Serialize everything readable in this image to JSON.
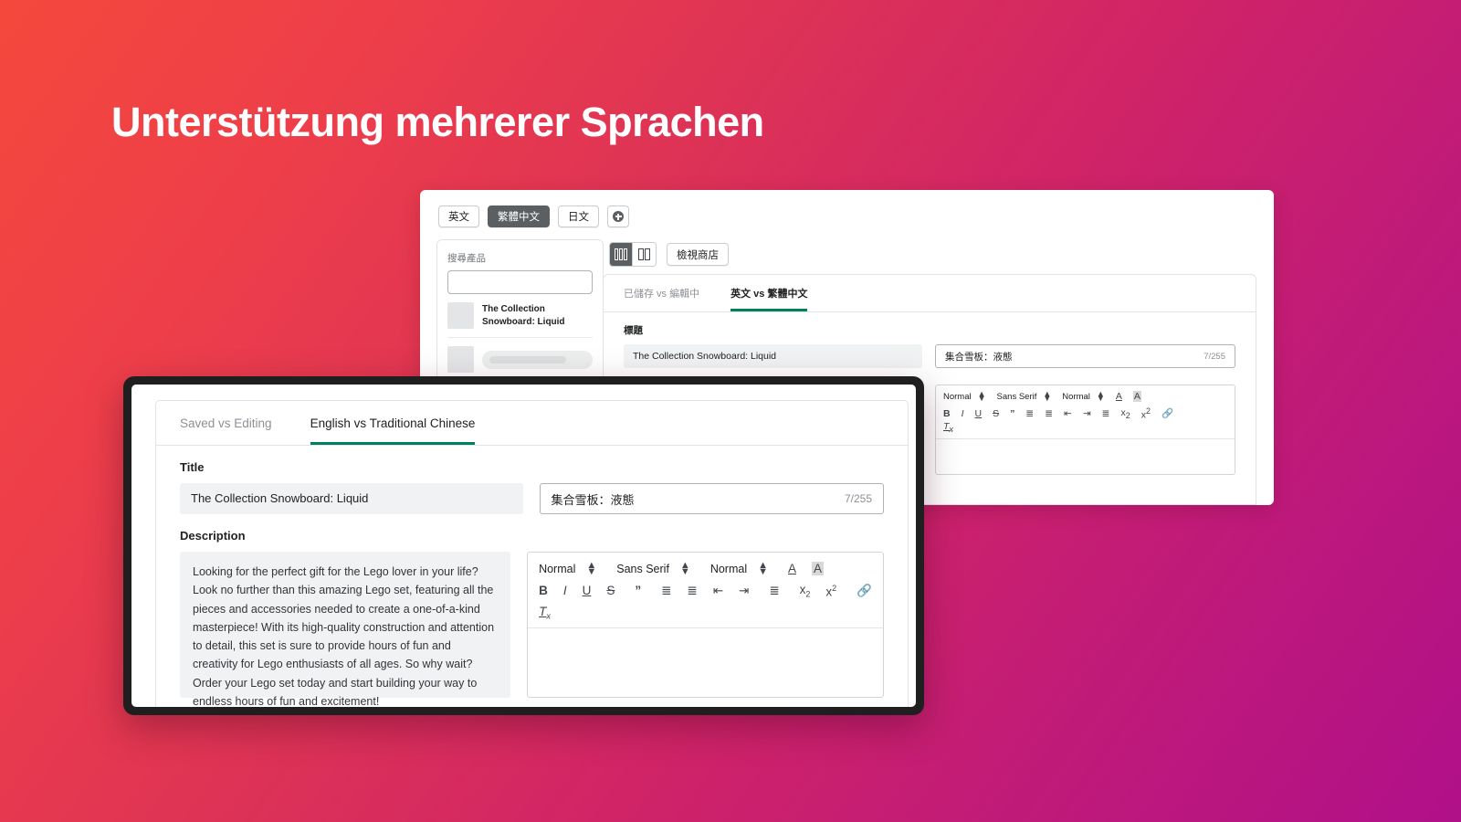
{
  "headline": "Unterstützung mehrerer Sprachen",
  "colors": {
    "gradient_start": "#f4483c",
    "gradient_mid": "#de3355",
    "gradient_end": "#b01089",
    "accent_green": "#008060",
    "chip_active_bg": "#5c5f62"
  },
  "back_panel": {
    "language_tabs": [
      {
        "label": "英文",
        "active": false
      },
      {
        "label": "繁體中文",
        "active": true
      },
      {
        "label": "日文",
        "active": false
      }
    ],
    "add_language_icon": "plus-circle-icon",
    "sidebar": {
      "search_label": "搜尋產品",
      "search_value": "",
      "items": [
        {
          "title": "The Collection Snowboard: Liquid",
          "placeholder": false
        },
        {
          "title": "",
          "placeholder": true
        },
        {
          "title": "",
          "placeholder": true
        }
      ]
    },
    "view_toggle": [
      {
        "icon": "three-column-icon",
        "active": true
      },
      {
        "icon": "two-column-icon",
        "active": false
      }
    ],
    "view_store_button": "檢視商店",
    "tabs": [
      {
        "label": "已儲存 vs 編輯中",
        "active": false
      },
      {
        "label": "英文 vs 繁體中文",
        "active": true
      }
    ],
    "title_label": "標題",
    "title_source": "The Collection Snowboard: Liquid",
    "title_translation": "集合雪板：液態",
    "title_counter": "7/255",
    "editor_toolbar": {
      "heading_select": "Normal",
      "font_select": "Sans Serif",
      "size_select": "Normal",
      "text_color_icon": "A",
      "bg_color_icon": "A",
      "bold": "B",
      "italic": "I",
      "underline": "U",
      "strike": "S",
      "blockquote": "”",
      "ordered_list": "ordered-list-icon",
      "bullet_list": "bullet-list-icon",
      "outdent": "outdent-icon",
      "indent": "indent-icon",
      "align": "align-icon",
      "subscript": "x",
      "subscript_mark": "2",
      "superscript": "x",
      "superscript_mark": "2",
      "link": "link-icon",
      "clear_format": "T",
      "clear_format_mark": "x"
    }
  },
  "front_panel": {
    "tabs": [
      {
        "label": "Saved vs Editing",
        "active": false
      },
      {
        "label": "English vs Traditional Chinese",
        "active": true
      }
    ],
    "title_label": "Title",
    "title_source": "The Collection Snowboard: Liquid",
    "title_translation": "集合雪板：液態",
    "title_counter": "7/255",
    "description_label": "Description",
    "description_source": "Looking for the perfect gift for the Lego lover in your life? Look no further than this amazing Lego set, featuring all the pieces and accessories needed to create a one-of-a-kind masterpiece! With its high-quality construction and attention to detail, this set is sure to provide hours of fun and creativity for Lego enthusiasts of all ages. So why wait? Order your Lego set today and start building your way to endless hours of fun and excitement!",
    "description_translation": "",
    "editor_toolbar": {
      "heading_select": "Normal",
      "font_select": "Sans Serif",
      "size_select": "Normal",
      "text_color_icon": "A",
      "bg_color_icon": "A",
      "bold": "B",
      "italic": "I",
      "underline": "U",
      "strike": "S",
      "blockquote": "”",
      "ordered_list": "ordered-list-icon",
      "bullet_list": "bullet-list-icon",
      "outdent": "outdent-icon",
      "indent": "indent-icon",
      "align": "align-icon",
      "subscript": "x",
      "subscript_mark": "2",
      "superscript": "x",
      "superscript_mark": "2",
      "link": "link-icon",
      "clear_format": "T",
      "clear_format_mark": "x"
    }
  }
}
